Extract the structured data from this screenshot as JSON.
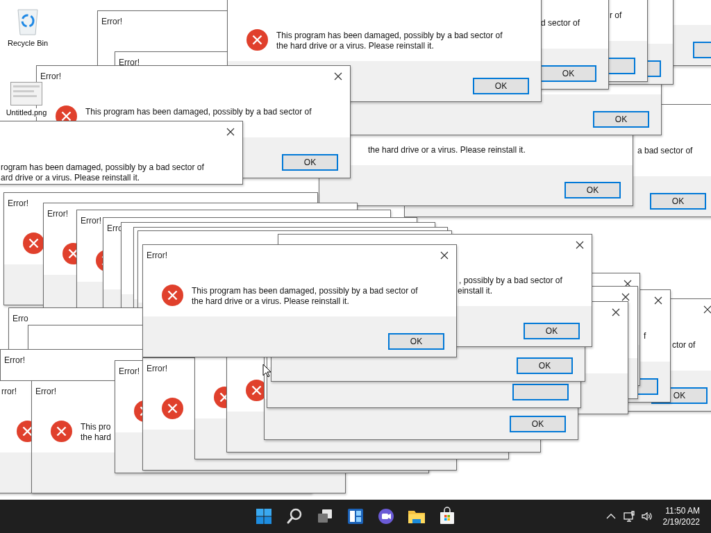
{
  "desktop_icons": [
    {
      "label": "Recycle Bin"
    },
    {
      "label": "Untitled.png"
    }
  ],
  "windows": [
    {
      "kind": "dialog",
      "title": "Error!"
    },
    {
      "kind": "dialog",
      "title": "Error!"
    },
    {
      "kind": "dialog"
    },
    {
      "kind": "dialog"
    },
    {
      "kind": "dialog",
      "message": [
        "r of"
      ]
    },
    {
      "kind": "dialog",
      "message": [
        "d sector of"
      ],
      "button": "OK"
    },
    {
      "kind": "dialog",
      "message": [
        "the hard drive or a virus. Please reinstall it."
      ],
      "button": "OK"
    },
    {
      "kind": "dialog",
      "message": [
        "a bad sector of"
      ],
      "button": "OK"
    },
    {
      "kind": "dialog",
      "button": "OK"
    },
    {
      "kind": "dialog",
      "message": [
        "This program has been damaged, possibly by a bad sector of",
        "the hard drive or a virus. Please reinstall it."
      ],
      "button": "OK"
    },
    {
      "kind": "dialog",
      "title": "Error!",
      "message": [
        "This program has been damaged, possibly by a bad sector of"
      ],
      "button": "OK"
    },
    {
      "kind": "dialog",
      "message": [
        "rogram has been damaged, possibly by a bad sector of",
        "ard drive or a virus. Please reinstall it."
      ]
    },
    {
      "kind": "dialog",
      "title": "Error!"
    },
    {
      "kind": "dialog",
      "title": "Error!"
    },
    {
      "kind": "dialog",
      "title": "Error!"
    },
    {
      "kind": "dialog",
      "title": "Erro"
    },
    {
      "kind": "dialog"
    },
    {
      "kind": "dialog"
    },
    {
      "kind": "dialog"
    },
    {
      "kind": "dialog",
      "title": "Erro"
    },
    {
      "kind": "dialog"
    },
    {
      "kind": "dialog",
      "title": "Error!"
    },
    {
      "kind": "dialog",
      "title": "rror!"
    },
    {
      "kind": "dialog",
      "title": "Error!",
      "message": [
        "This pro",
        "the hard"
      ]
    },
    {
      "kind": "dialog",
      "title": "Error!"
    },
    {
      "kind": "dialog",
      "title": "Error!"
    },
    {
      "kind": "dialog"
    },
    {
      "kind": "dialog"
    },
    {
      "kind": "dialog",
      "message": [
        "ctor of"
      ],
      "button": "OK"
    },
    {
      "kind": "dialog",
      "message": [
        "f"
      ]
    },
    {
      "kind": "dialog"
    },
    {
      "kind": "dialog"
    },
    {
      "kind": "dialog"
    },
    {
      "kind": "dialog",
      "message": [
        ", possibly by a bad sector of",
        "einstall it."
      ],
      "button": "OK"
    },
    {
      "kind": "dialog",
      "button": "OK"
    },
    {
      "kind": "dialog"
    },
    {
      "kind": "dialog",
      "button": "OK"
    },
    {
      "kind": "dialog",
      "title": "Error!",
      "message": [
        "This program has been damaged, possibly by a bad sector of",
        "the hard drive or a virus. Please reinstall it."
      ],
      "button": "OK"
    }
  ],
  "taskbar": {
    "time": "11:50 AM",
    "date": "2/19/2022"
  }
}
